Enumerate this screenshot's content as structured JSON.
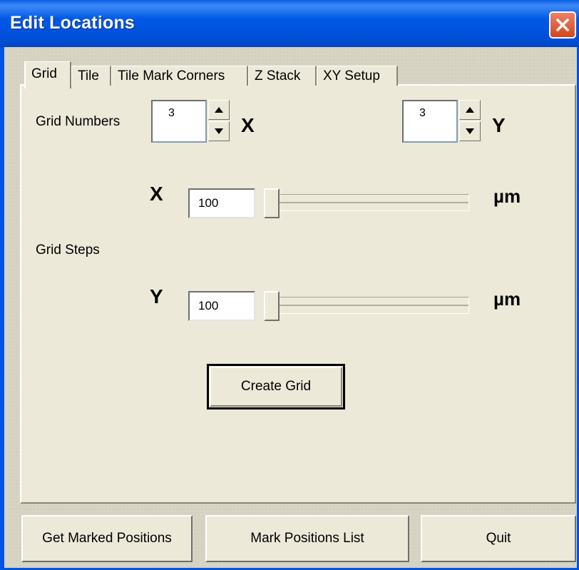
{
  "window": {
    "title": "Edit Locations"
  },
  "tabs": [
    {
      "label": "Grid"
    },
    {
      "label": "Tile"
    },
    {
      "label": "Tile Mark Corners"
    },
    {
      "label": "Z Stack"
    },
    {
      "label": "XY Setup"
    }
  ],
  "grid": {
    "numbers_label": "Grid Numbers",
    "x_count": "3",
    "x_axis": "X",
    "y_count": "3",
    "y_axis": "Y",
    "steps_label": "Grid Steps",
    "step_x_axis": "X",
    "step_x_value": "100",
    "step_x_unit": "µm",
    "step_y_axis": "Y",
    "step_y_value": "100",
    "step_y_unit": "µm",
    "create_button": "Create Grid"
  },
  "footer": {
    "get_marked": "Get Marked Positions",
    "mark_list": "Mark Positions List",
    "quit": "Quit"
  }
}
